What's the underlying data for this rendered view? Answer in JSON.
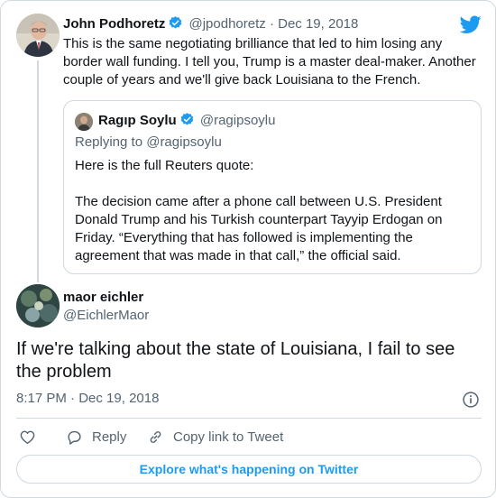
{
  "parent_tweet": {
    "name": "John Podhoretz",
    "handle": "@jpodhoretz",
    "separator": "·",
    "date": "Dec 19, 2018",
    "text": "This is the same negotiating brilliance that led to him losing any border wall funding. I tell you, Trump is a master deal-maker. Another couple of years and we'll give back Louisiana to the French."
  },
  "quoted_tweet": {
    "name": "Ragıp Soylu",
    "handle": "@ragipsoylu",
    "replying_to": "Replying to @ragipsoylu",
    "text": "Here is the full Reuters quote:\n\nThe decision came after a phone call between U.S. President Donald Trump and his Turkish counterpart Tayyip Erdogan on Friday. “Everything that has followed is implementing the agreement that was made in that call,” the official said."
  },
  "main_tweet": {
    "name": "maor eichler",
    "handle": "@EichlerMaor",
    "text": "If we're talking about the state of Louisiana, I fail to see the problem",
    "time": "8:17 PM",
    "separator": "·",
    "date": "Dec 19, 2018"
  },
  "actions": {
    "reply_label": "Reply",
    "copy_label": "Copy link to Tweet"
  },
  "explore": {
    "label": "Explore what's happening on Twitter"
  },
  "icons": {
    "brand": "twitter-bird-icon",
    "verified": "verified-badge-icon",
    "info": "info-icon",
    "like": "heart-icon",
    "reply": "reply-bubble-icon",
    "copy": "link-icon"
  },
  "colors": {
    "accent": "#1d9bf0",
    "text": "#0f1419",
    "muted": "#536471",
    "border": "#cfd9de"
  }
}
